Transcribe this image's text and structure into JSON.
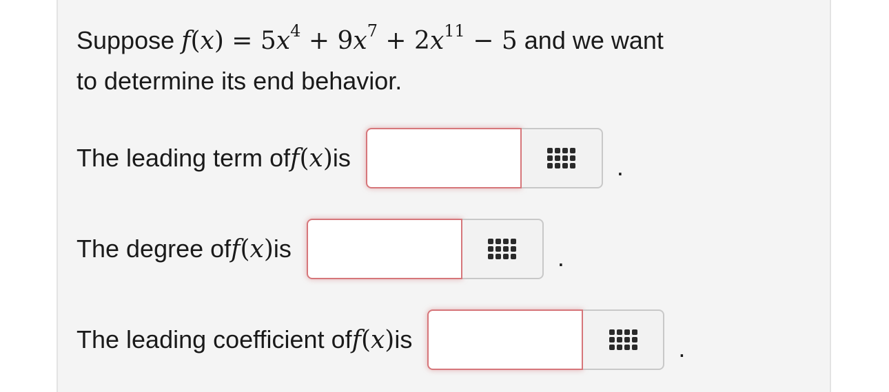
{
  "question": {
    "prefix": "Suppose ",
    "f": "f",
    "lparen": "(",
    "x": "x",
    "rparen": ")",
    "eq": " = ",
    "t1_coef": "5",
    "t1_var": "x",
    "t1_exp": "4",
    "plus1": " + ",
    "t2_coef": "9",
    "t2_var": "x",
    "t2_exp": "7",
    "plus2": " + ",
    "t3_coef": "2",
    "t3_var": "x",
    "t3_exp": "11",
    "minus": " − ",
    "const": "5",
    "suffix_line1": " and we want",
    "suffix_line2": "to determine its end behavior."
  },
  "rows": [
    {
      "before": "The leading term of ",
      "f": "f",
      "lparen": "(",
      "x": "x",
      "rparen": ")",
      "after": " is",
      "value": "",
      "period": "."
    },
    {
      "before": "The degree of ",
      "f": "f",
      "lparen": "(",
      "x": "x",
      "rparen": ")",
      "after": " is",
      "value": "",
      "period": "."
    },
    {
      "before": "The leading coefficient of ",
      "f": "f",
      "lparen": "(",
      "x": "x",
      "rparen": ")",
      "after": " is",
      "value": "",
      "period": "."
    }
  ],
  "icons": {
    "keypad": "keypad-grid-icon"
  },
  "colors": {
    "panel_bg": "#f4f4f4",
    "input_border_error": "#d6767a",
    "keypad_bg": "#f2f2f2"
  }
}
